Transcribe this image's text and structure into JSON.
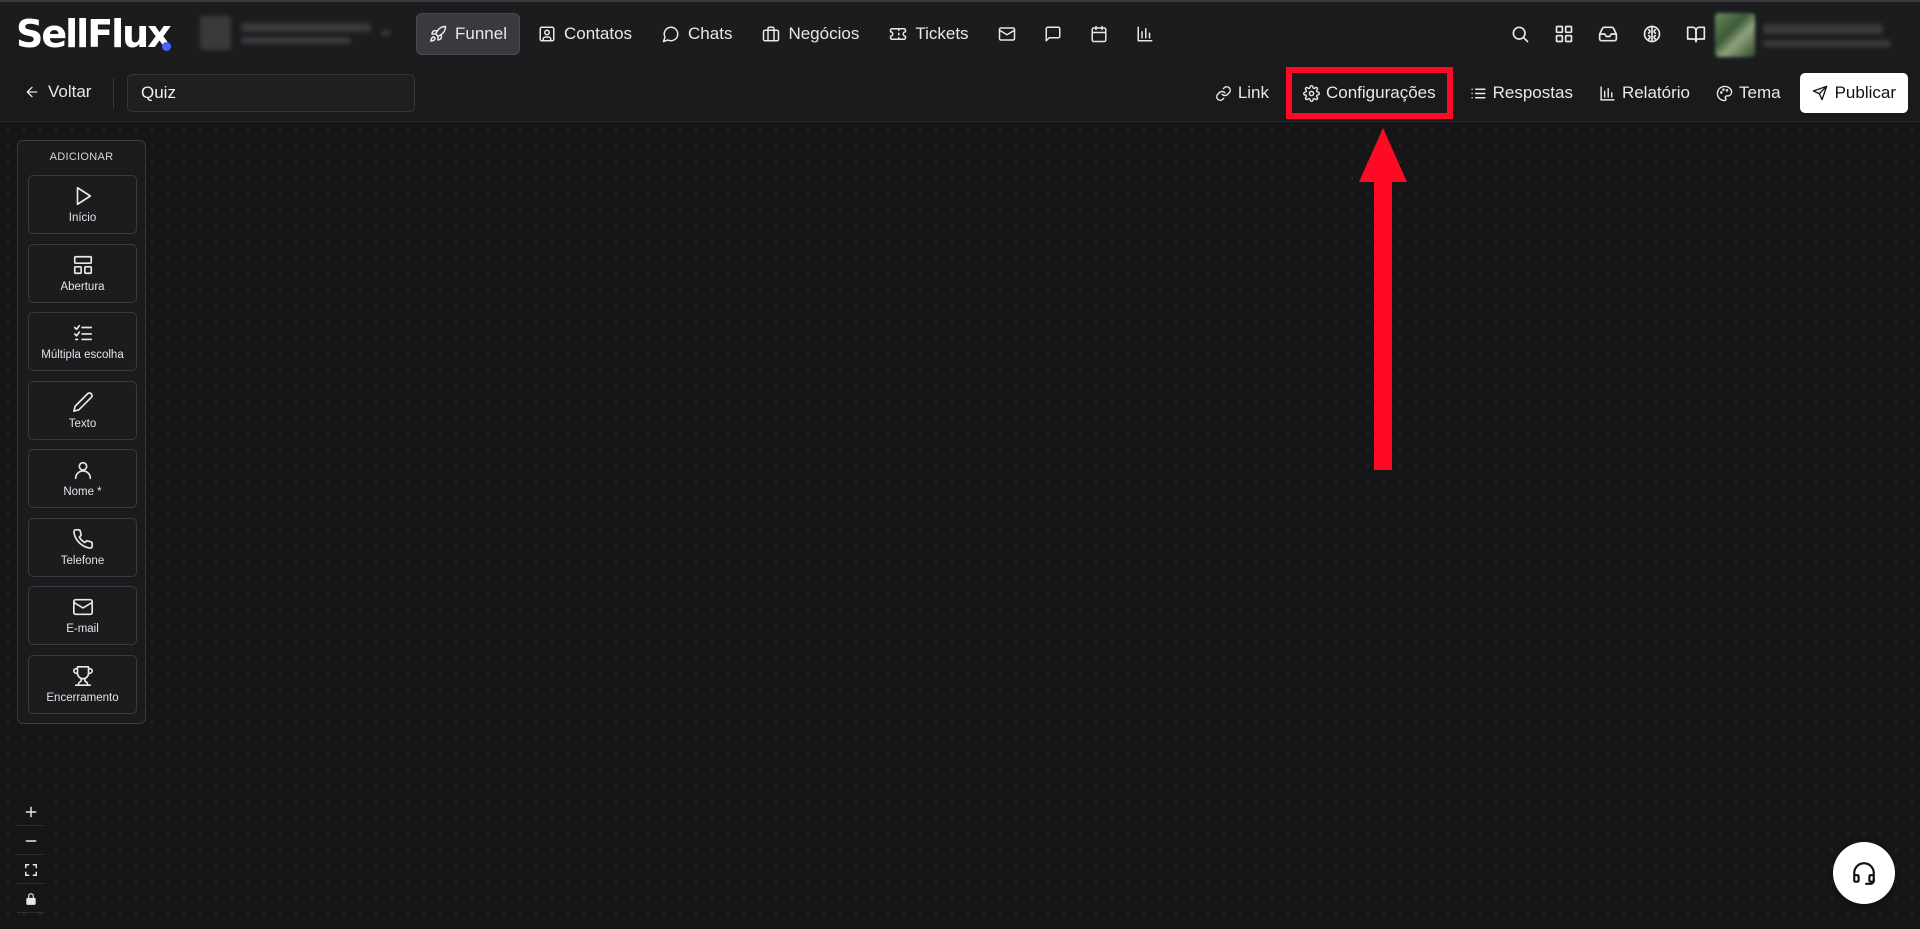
{
  "app": {
    "logo_text": "SellFlux",
    "accent": "#4a63ff"
  },
  "nav": {
    "items": [
      {
        "label": "Funnel",
        "icon": "rocket-icon",
        "active": true
      },
      {
        "label": "Contatos",
        "icon": "contact-card-icon"
      },
      {
        "label": "Chats",
        "icon": "chat-bubble-icon"
      },
      {
        "label": "Negócios",
        "icon": "briefcase-icon"
      },
      {
        "label": "Tickets",
        "icon": "ticket-icon"
      }
    ],
    "icon_items": [
      "mail-icon",
      "message-square-icon",
      "calendar-icon",
      "bar-chart-icon"
    ]
  },
  "topbar_right_icons": [
    "search-icon",
    "apps-grid-icon",
    "inbox-icon",
    "brain-icon",
    "book-icon",
    "headset-icon"
  ],
  "subbar": {
    "back_label": "Voltar",
    "title_value": "Quiz",
    "actions": [
      {
        "label": "Link",
        "icon": "link-icon"
      },
      {
        "label": "Configurações",
        "icon": "gear-icon",
        "highlighted": true
      },
      {
        "label": "Respostas",
        "icon": "list-icon"
      },
      {
        "label": "Relatório",
        "icon": "bar-chart-icon"
      },
      {
        "label": "Tema",
        "icon": "palette-icon"
      }
    ],
    "publish_label": "Publicar"
  },
  "palette": {
    "title": "ADICIONAR",
    "blocks": [
      {
        "label": "Início",
        "icon": "play-icon"
      },
      {
        "label": "Abertura",
        "icon": "layout-icon"
      },
      {
        "label": "Múltipla escolha",
        "icon": "checklist-icon"
      },
      {
        "label": "Texto",
        "icon": "pencil-icon"
      },
      {
        "label": "Nome *",
        "icon": "user-icon"
      },
      {
        "label": "Telefone",
        "icon": "phone-icon"
      },
      {
        "label": "E-mail",
        "icon": "mail-icon"
      },
      {
        "label": "Encerramento",
        "icon": "trophy-icon"
      }
    ]
  },
  "zoom_controls": [
    "zoom-in-icon",
    "zoom-out-icon",
    "fit-view-icon",
    "lock-icon"
  ],
  "annotation": {
    "color": "#ff0a24"
  }
}
